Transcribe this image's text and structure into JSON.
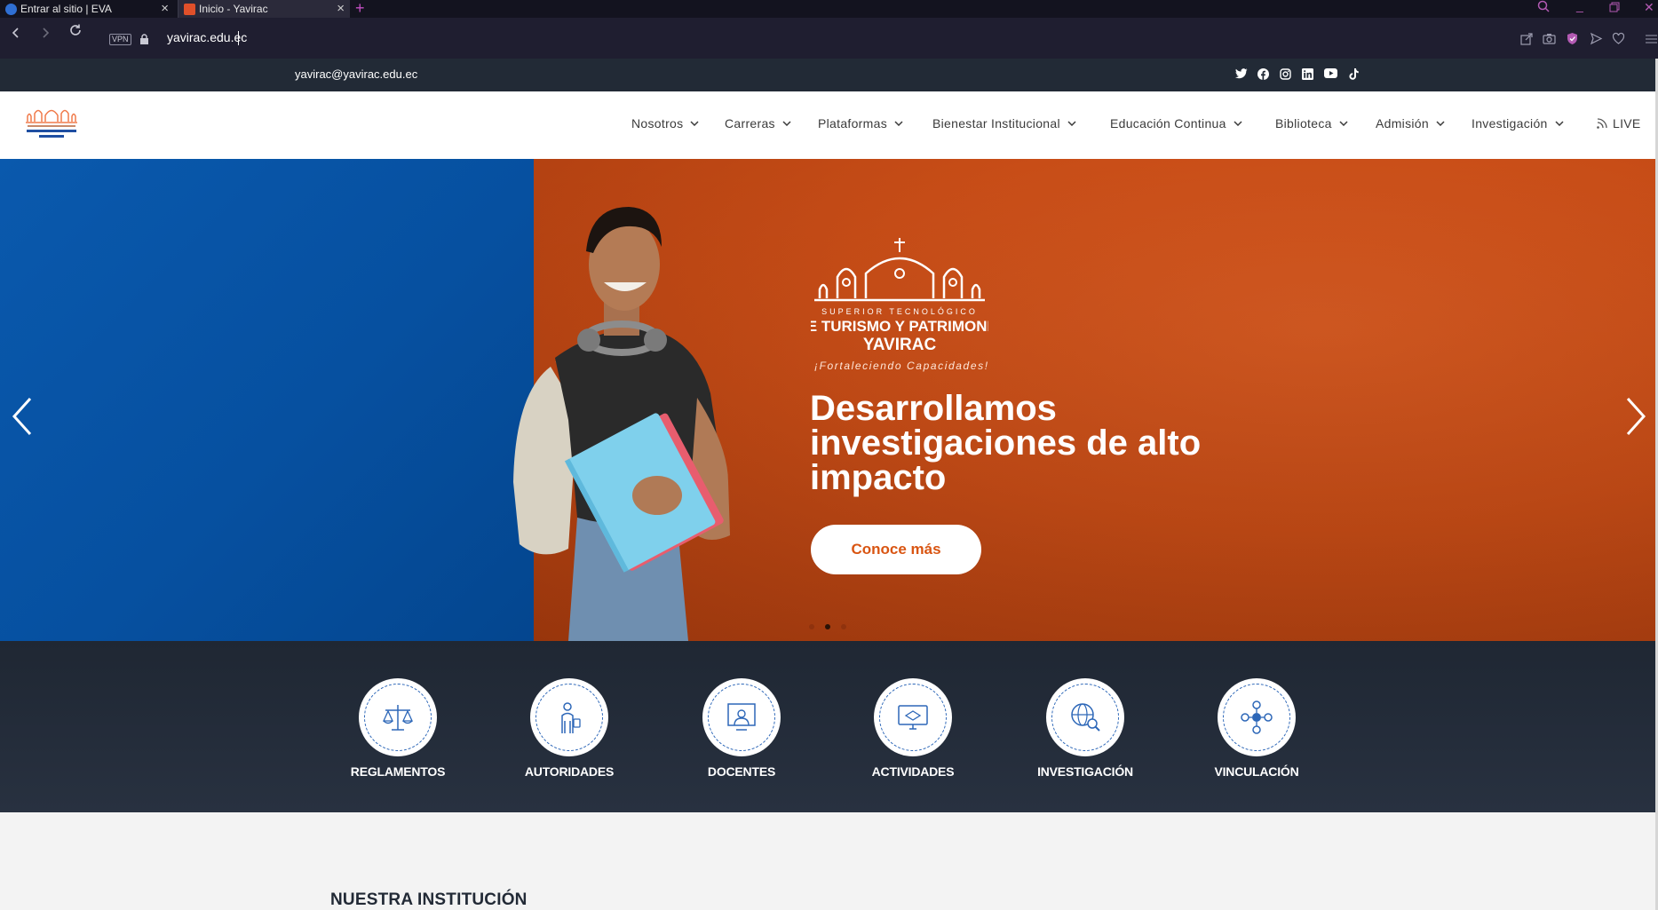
{
  "browser": {
    "tabs": [
      {
        "label": "Entrar al sitio | EVA",
        "active": false
      },
      {
        "label": "Inicio - Yavirac",
        "active": true
      }
    ],
    "vpn_badge": "VPN",
    "url": "yavirac.edu.ec"
  },
  "topbar": {
    "email": "yavirac@yavirac.edu.ec",
    "social_icons": [
      "twitter-icon",
      "facebook-icon",
      "instagram-icon",
      "linkedin-icon",
      "youtube-icon",
      "tiktok-icon"
    ]
  },
  "header": {
    "nav": [
      {
        "label": "Nosotros"
      },
      {
        "label": "Carreras"
      },
      {
        "label": "Plataformas"
      },
      {
        "label": "Bienestar Institucional"
      },
      {
        "label": "Educación Continua"
      },
      {
        "label": "Biblioteca"
      },
      {
        "label": "Admisión"
      },
      {
        "label": "Investigación"
      }
    ],
    "live_label": "LIVE"
  },
  "hero": {
    "logo_text": {
      "line1": "SUPERIOR TECNOLÓGICO",
      "line2": "DE TURISMO Y PATRIMONIO",
      "line3": "YAVIRAC"
    },
    "tagline": "¡Fortaleciendo Capacidades!",
    "headline": "Desarrollamos investigaciones de alto impacto",
    "cta_label": "Conoce más",
    "slides_total": 3,
    "active_slide": 2
  },
  "quick_links": [
    {
      "label": "REGLAMENTOS",
      "icon": "scales-icon"
    },
    {
      "label": "AUTORIDADES",
      "icon": "person-icon"
    },
    {
      "label": "DOCENTES",
      "icon": "teacher-icon"
    },
    {
      "label": "ACTIVIDADES",
      "icon": "monitor-icon"
    },
    {
      "label": "INVESTIGACIÓN",
      "icon": "globe-search-icon"
    },
    {
      "label": "VINCULACIÓN",
      "icon": "network-people-icon"
    }
  ],
  "section": {
    "title": "NUESTRA INSTITUCIÓN"
  },
  "colors": {
    "brand_orange": "#d55a22",
    "brand_blue": "#0650a0",
    "dark_bar": "#222a36"
  }
}
